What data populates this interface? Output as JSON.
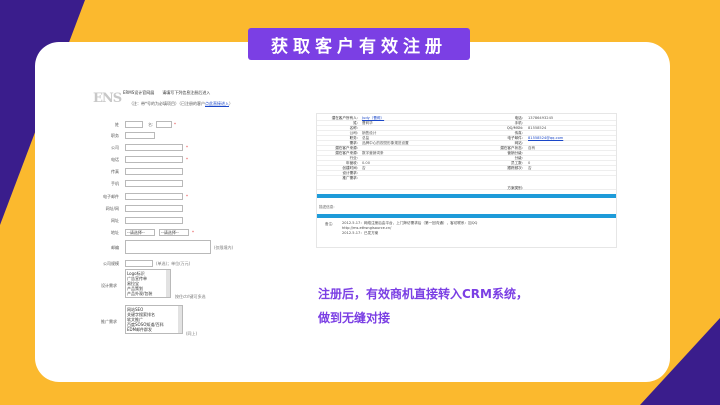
{
  "title": "获取客户有效注册",
  "colors": {
    "accent": "#7b3fe4",
    "background": "#3a1d8c",
    "highlight": "#fbb92e",
    "crm_bar": "#1e9bd9"
  },
  "caption": {
    "line1": "注册后，有效商机直接转入CRM系统，",
    "line2": "做到无缝对接"
  },
  "form": {
    "logo": "ENS",
    "header": "ERMS设计官网展　　请填写下列信息注册后进入",
    "note_prefix": "（注：带*号的为必填项目）（已注册的客户",
    "note_link": "点此直接进入",
    "note_suffix": "）",
    "fields": [
      {
        "label": "姓",
        "extra": "名:"
      },
      {
        "label": "职务"
      },
      {
        "label": "公司"
      },
      {
        "label": "电话"
      },
      {
        "label": "传真"
      },
      {
        "label": "手机"
      },
      {
        "label": "电子邮件"
      },
      {
        "label": "网址/网"
      },
      {
        "label": "网址"
      },
      {
        "label": "地址",
        "select1": "--请选择--",
        "select2": "--请选择--"
      },
      {
        "label": "邮编",
        "extra": "(仅限境内)"
      },
      {
        "label": "公司规模",
        "extra": "(单选)；单位(万元)"
      }
    ],
    "design_label": "设计需求",
    "design_items": [
      "Logo标识",
      "广告宣传单",
      "易拉宝",
      "产品策划",
      "产品外观/包装"
    ],
    "design_note": "按住ctrl键可多选",
    "promo_label": "推广需求",
    "promo_items": [
      "网站SEO",
      "关键字搜索排名",
      "软文推广",
      "百度SOSO知道/百科",
      "EDM邮件群发"
    ],
    "promo_note": "(同上)"
  },
  "crm": {
    "rows": [
      {
        "l": "潜在客户所有人:",
        "v": "Judy（曹莉）",
        "vlink": true,
        "rl": "电话:",
        "rv": "13786493245"
      },
      {
        "l": "姓:",
        "v": "曹莉华",
        "rl": "手机:",
        "rv": ""
      },
      {
        "l": "名称:",
        "v": "",
        "rl": "QQ/MSN:",
        "rv": "81558524"
      },
      {
        "l": "公司:",
        "v": "销售设计",
        "rl": "传真:",
        "rv": ""
      },
      {
        "l": "职务:",
        "v": "总监",
        "rl": "电子邮件:",
        "rv": "81558524@qq.com",
        "rvlink": true
      },
      {
        "l": "需求:",
        "v": "品牌中心的视觉形象规范设置",
        "rl": "网站:",
        "rv": ""
      },
      {
        "l": "潜在客户来源:",
        "v": "",
        "rl": "潜在客户状态:",
        "rv": "自有"
      },
      {
        "l": "潜在客户来源:",
        "v": "数字营销词条",
        "rl": "营销分级:",
        "rv": ""
      },
      {
        "l": "行业:",
        "v": "",
        "rl": "分级:",
        "rv": ""
      },
      {
        "l": "年营收:",
        "v": "0.00",
        "rl": "员工数:",
        "rv": "0"
      },
      {
        "l": "创建时间:",
        "v": "否",
        "rl": "跟踪频次:",
        "rv": "否"
      },
      {
        "l": "设计需求:",
        "v": "",
        "rl": "",
        "rv": ""
      },
      {
        "l": "推广需求:",
        "v": "",
        "rl": "方案类别:",
        "rv": ""
      }
    ],
    "section_label": "描述信息:",
    "notes_label": "备注:",
    "notes": [
      "2012.5.17：网络注册后由平台，上门拜访需求后（第一回沟通），客访联系：加QQ",
      "http://ms.ethsnglsource.cn/",
      "2012.5.17：已发方案"
    ]
  }
}
